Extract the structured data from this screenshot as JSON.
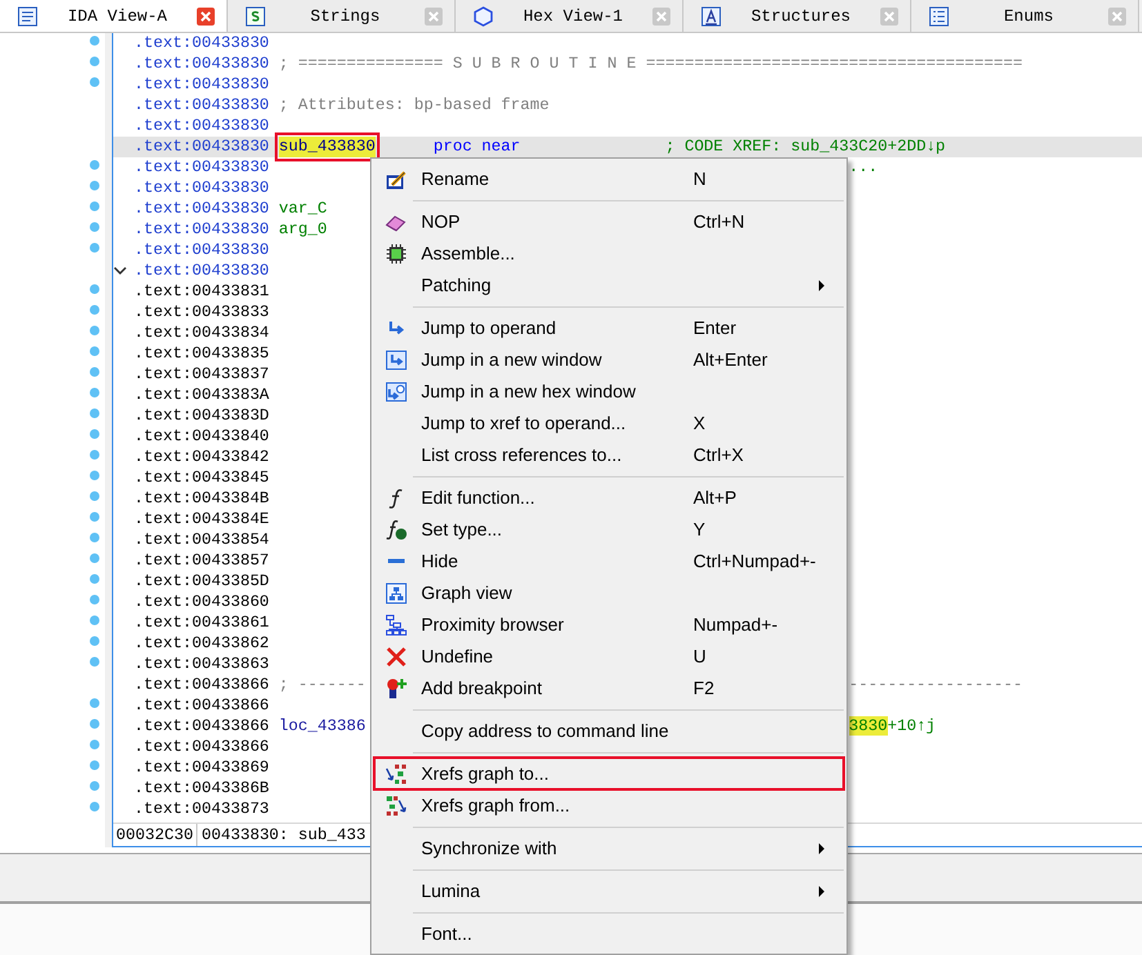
{
  "tabs": [
    {
      "label": "IDA View-A",
      "selected": true
    },
    {
      "label": "Strings",
      "selected": false
    },
    {
      "label": "Hex View-1",
      "selected": false
    },
    {
      "label": "Structures",
      "selected": false
    },
    {
      "label": "Enums",
      "selected": false
    }
  ],
  "lines": [
    {
      "address": ".text:00433830",
      "color": "#1f3fcf",
      "dot": true,
      "fold": false,
      "current": false
    },
    {
      "address": ".text:00433830",
      "color": "#1f3fcf",
      "dot": true,
      "fold": false,
      "current": false,
      "parts": [
        {
          "text": "; =============== S U B R O U T I N E =======================================",
          "kind": "comment"
        }
      ]
    },
    {
      "address": ".text:00433830",
      "color": "#1f3fcf",
      "dot": true,
      "fold": false,
      "current": false
    },
    {
      "address": ".text:00433830",
      "color": "#1f3fcf",
      "dot": false,
      "fold": false,
      "current": false,
      "parts": [
        {
          "text": "; Attributes: bp-based frame",
          "kind": "comment"
        }
      ]
    },
    {
      "address": ".text:00433830",
      "color": "#1f3fcf",
      "dot": false,
      "fold": false,
      "current": false
    },
    {
      "address": ".text:00433830",
      "color": "#1f3fcf",
      "dot": false,
      "fold": false,
      "current": true,
      "parts": [
        {
          "text": "sub_433830",
          "kind": "name",
          "highlight": true,
          "boxed": true
        },
        {
          "text": "proc near",
          "kind": "op"
        },
        {
          "text": "; CODE XREF: sub_433C20+2DD↓p",
          "kind": "xref"
        }
      ]
    },
    {
      "address": ".text:00433830",
      "color": "#1f3fcf",
      "dot": true,
      "fold": false,
      "current": false,
      "tail": [
        {
          "text": "...",
          "kind": "xref"
        }
      ]
    },
    {
      "address": ".text:00433830",
      "color": "#1f3fcf",
      "dot": true,
      "fold": false,
      "current": false
    },
    {
      "address": ".text:00433830",
      "color": "#1f3fcf",
      "dot": true,
      "fold": false,
      "current": false,
      "parts": [
        {
          "text": "var_C",
          "kind": "var"
        }
      ]
    },
    {
      "address": ".text:00433830",
      "color": "#1f3fcf",
      "dot": true,
      "fold": false,
      "current": false,
      "parts": [
        {
          "text": "arg_0",
          "kind": "var"
        }
      ]
    },
    {
      "address": ".text:00433830",
      "color": "#1f3fcf",
      "dot": true,
      "fold": false,
      "current": false
    },
    {
      "address": ".text:00433830",
      "color": "#1f3fcf",
      "dot": false,
      "fold": true,
      "current": false
    },
    {
      "address": ".text:00433831",
      "color": "#000000",
      "dot": true,
      "fold": false,
      "current": false
    },
    {
      "address": ".text:00433833",
      "color": "#000000",
      "dot": true,
      "fold": false,
      "current": false
    },
    {
      "address": ".text:00433834",
      "color": "#000000",
      "dot": true,
      "fold": false,
      "current": false
    },
    {
      "address": ".text:00433835",
      "color": "#000000",
      "dot": true,
      "fold": false,
      "current": false
    },
    {
      "address": ".text:00433837",
      "color": "#000000",
      "dot": true,
      "fold": false,
      "current": false
    },
    {
      "address": ".text:0043383A",
      "color": "#000000",
      "dot": true,
      "fold": false,
      "current": false
    },
    {
      "address": ".text:0043383D",
      "color": "#000000",
      "dot": true,
      "fold": false,
      "current": false
    },
    {
      "address": ".text:00433840",
      "color": "#000000",
      "dot": true,
      "fold": false,
      "current": false
    },
    {
      "address": ".text:00433842",
      "color": "#000000",
      "dot": true,
      "fold": false,
      "current": false
    },
    {
      "address": ".text:00433845",
      "color": "#000000",
      "dot": true,
      "fold": false,
      "current": false
    },
    {
      "address": ".text:0043384B",
      "color": "#000000",
      "dot": true,
      "fold": false,
      "current": false
    },
    {
      "address": ".text:0043384E",
      "color": "#000000",
      "dot": true,
      "fold": false,
      "current": false
    },
    {
      "address": ".text:00433854",
      "color": "#000000",
      "dot": true,
      "fold": false,
      "current": false
    },
    {
      "address": ".text:00433857",
      "color": "#000000",
      "dot": true,
      "fold": false,
      "current": false
    },
    {
      "address": ".text:0043385D",
      "color": "#000000",
      "dot": true,
      "fold": false,
      "current": false
    },
    {
      "address": ".text:00433860",
      "color": "#000000",
      "dot": true,
      "fold": false,
      "current": false
    },
    {
      "address": ".text:00433861",
      "color": "#000000",
      "dot": true,
      "fold": false,
      "current": false
    },
    {
      "address": ".text:00433862",
      "color": "#000000",
      "dot": true,
      "fold": false,
      "current": false
    },
    {
      "address": ".text:00433863",
      "color": "#000000",
      "dot": true,
      "fold": false,
      "current": false
    },
    {
      "address": ".text:00433866",
      "color": "#000000",
      "dot": false,
      "fold": false,
      "current": false,
      "parts": [
        {
          "text": "; -------",
          "kind": "comment"
        }
      ],
      "tail": [
        {
          "text": "------------------",
          "kind": "comment"
        }
      ]
    },
    {
      "address": ".text:00433866",
      "color": "#000000",
      "dot": true,
      "fold": false,
      "current": false
    },
    {
      "address": ".text:00433866",
      "color": "#000000",
      "dot": true,
      "fold": false,
      "current": false,
      "parts": [
        {
          "text": "loc_43386",
          "kind": "label"
        }
      ],
      "tail": [
        {
          "text": "3830",
          "kind": "xref",
          "highlight": true
        },
        {
          "text": "+10↑j",
          "kind": "xref"
        }
      ]
    },
    {
      "address": ".text:00433866",
      "color": "#000000",
      "dot": true,
      "fold": false,
      "current": false
    },
    {
      "address": ".text:00433869",
      "color": "#000000",
      "dot": true,
      "fold": false,
      "current": false
    },
    {
      "address": ".text:0043386B",
      "color": "#000000",
      "dot": true,
      "fold": false,
      "current": false
    },
    {
      "address": ".text:00433873",
      "color": "#000000",
      "dot": true,
      "fold": false,
      "current": false
    }
  ],
  "status_bar": {
    "offset": "00032C30",
    "location": "00433830: sub_433"
  },
  "context_menu": {
    "entries": [
      {
        "kind": "item",
        "label": "Rename",
        "shortcut": "N"
      },
      {
        "kind": "separator"
      },
      {
        "kind": "item",
        "label": "NOP",
        "shortcut": "Ctrl+N"
      },
      {
        "kind": "item",
        "label": "Assemble..."
      },
      {
        "kind": "item",
        "label": "Patching",
        "submenu": true
      },
      {
        "kind": "separator"
      },
      {
        "kind": "item",
        "label": "Jump to operand",
        "shortcut": "Enter"
      },
      {
        "kind": "item",
        "label": "Jump in a new window",
        "shortcut": "Alt+Enter"
      },
      {
        "kind": "item",
        "label": "Jump in a new hex window"
      },
      {
        "kind": "item",
        "label": "Jump to xref to operand...",
        "shortcut": "X"
      },
      {
        "kind": "item",
        "label": "List cross references to...",
        "shortcut": "Ctrl+X"
      },
      {
        "kind": "separator"
      },
      {
        "kind": "item",
        "label": "Edit function...",
        "shortcut": "Alt+P"
      },
      {
        "kind": "item",
        "label": "Set type...",
        "shortcut": "Y"
      },
      {
        "kind": "item",
        "label": "Hide",
        "shortcut": "Ctrl+Numpad+-"
      },
      {
        "kind": "item",
        "label": "Graph view"
      },
      {
        "kind": "item",
        "label": "Proximity browser",
        "shortcut": "Numpad+-"
      },
      {
        "kind": "item",
        "label": "Undefine",
        "shortcut": "U"
      },
      {
        "kind": "item",
        "label": "Add breakpoint",
        "shortcut": "F2"
      },
      {
        "kind": "separator"
      },
      {
        "kind": "item",
        "label": "Copy address to command line"
      },
      {
        "kind": "separator"
      },
      {
        "kind": "item",
        "label": "Xrefs graph to...",
        "boxed": true
      },
      {
        "kind": "item",
        "label": "Xrefs graph from..."
      },
      {
        "kind": "separator"
      },
      {
        "kind": "item",
        "label": "Synchronize with",
        "submenu": true
      },
      {
        "kind": "separator"
      },
      {
        "kind": "item",
        "label": "Lumina",
        "submenu": true
      },
      {
        "kind": "separator"
      },
      {
        "kind": "item",
        "label": "Font..."
      }
    ]
  }
}
